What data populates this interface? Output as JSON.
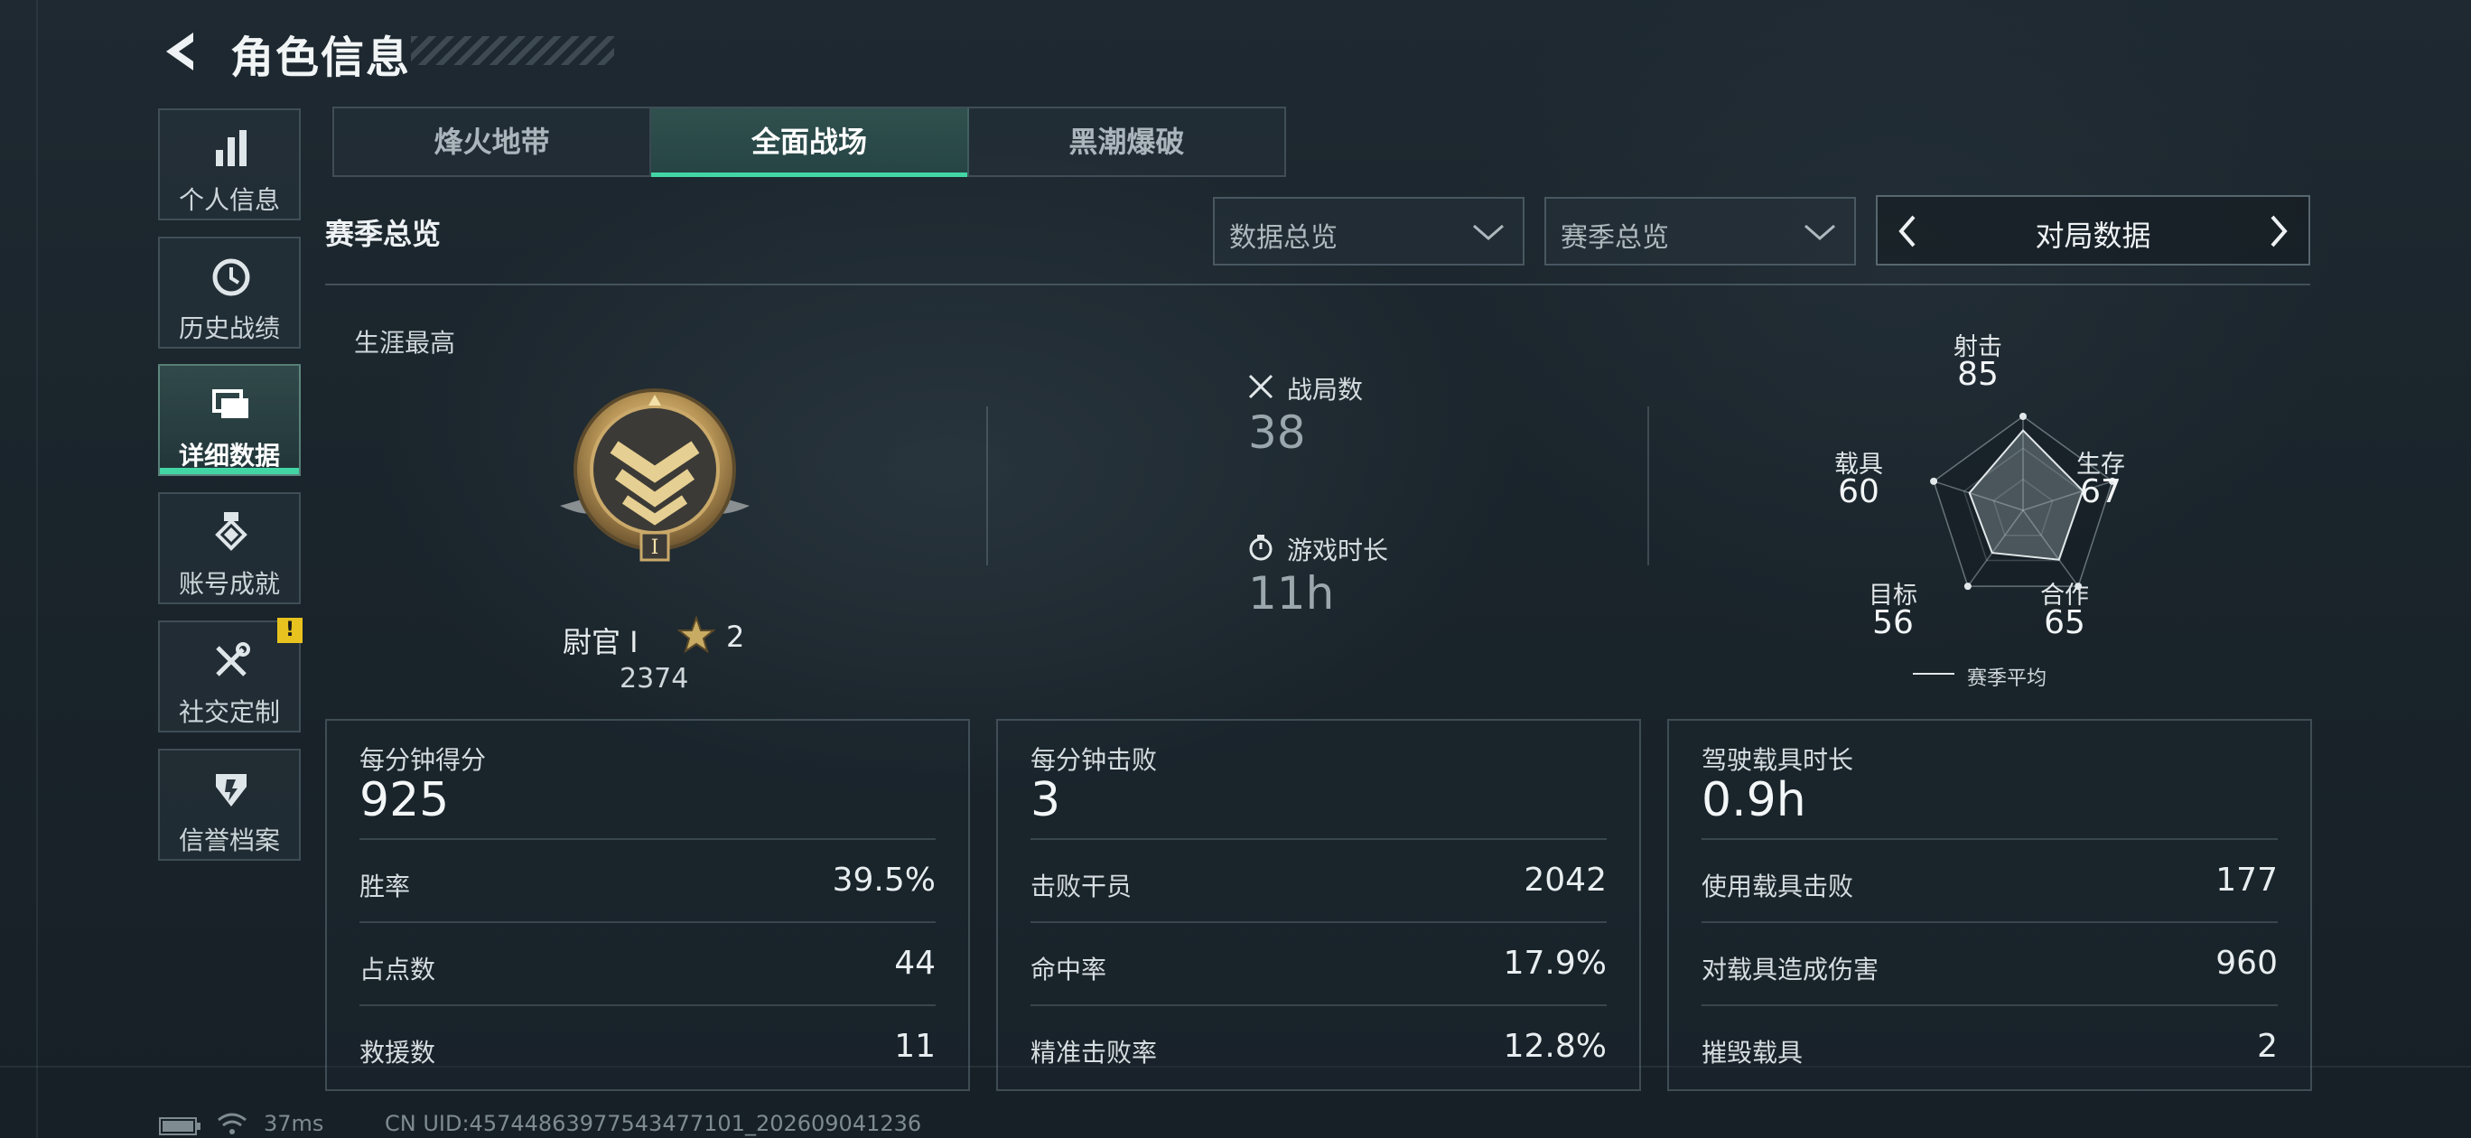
{
  "header": {
    "title": "角色信息"
  },
  "sidebar": {
    "items": [
      {
        "label": "个人信息",
        "icon": "bar-chart-icon",
        "active": false
      },
      {
        "label": "历史战绩",
        "icon": "history-clock-icon",
        "active": false
      },
      {
        "label": "详细数据",
        "icon": "folder-icon",
        "active": true
      },
      {
        "label": "账号成就",
        "icon": "medal-icon",
        "active": false
      },
      {
        "label": "社交定制",
        "icon": "tools-icon",
        "active": false,
        "badge": "!"
      },
      {
        "label": "信誉档案",
        "icon": "shield-icon",
        "active": false
      }
    ]
  },
  "tabs": [
    {
      "label": "烽火地带",
      "active": false
    },
    {
      "label": "全面战场",
      "active": true
    },
    {
      "label": "黑潮爆破",
      "active": false
    }
  ],
  "filters": {
    "section_title": "赛季总览",
    "dropdown1": "数据总览",
    "dropdown2": "赛季总览",
    "switcher": "对局数据"
  },
  "rank": {
    "career_label": "生涯最高",
    "name": "尉官 I",
    "stars": "2",
    "points": "2374",
    "emblem_numeral": "I"
  },
  "overview": {
    "matches_label": "战局数",
    "matches_value": "38",
    "time_label": "游戏时长",
    "time_value": "11h"
  },
  "radar": {
    "axes": [
      {
        "name": "射击",
        "value": "85"
      },
      {
        "name": "生存",
        "value": "67"
      },
      {
        "name": "合作",
        "value": "65"
      },
      {
        "name": "目标",
        "value": "56"
      },
      {
        "name": "载具",
        "value": "60"
      }
    ],
    "legend": "赛季平均"
  },
  "cards": [
    {
      "head_label": "每分钟得分",
      "head_value": "925",
      "rows": [
        {
          "k": "胜率",
          "v": "39.5%"
        },
        {
          "k": "占点数",
          "v": "44"
        },
        {
          "k": "救援数",
          "v": "11"
        }
      ]
    },
    {
      "head_label": "每分钟击败",
      "head_value": "3",
      "rows": [
        {
          "k": "击败干员",
          "v": "2042"
        },
        {
          "k": "命中率",
          "v": "17.9%"
        },
        {
          "k": "精准击败率",
          "v": "12.8%"
        }
      ]
    },
    {
      "head_label": "驾驶载具时长",
      "head_value": "0.9h",
      "rows": [
        {
          "k": "使用载具击败",
          "v": "177"
        },
        {
          "k": "对载具造成伤害",
          "v": "960"
        },
        {
          "k": "摧毁载具",
          "v": "2"
        }
      ]
    }
  ],
  "footer": {
    "ping": "37ms",
    "uid": "CN UID:45744863977543477101_202609041236"
  },
  "colors": {
    "accent": "#43d6a5",
    "badge": "#e8c21e",
    "background": "#1b252c"
  }
}
